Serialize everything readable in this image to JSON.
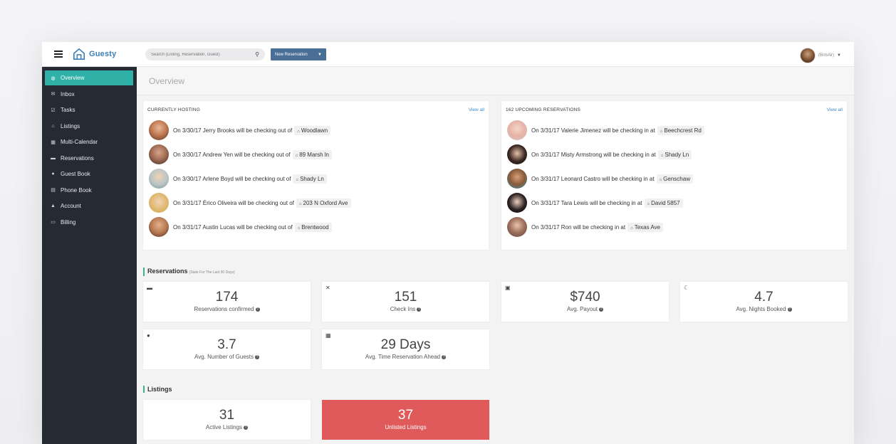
{
  "brand": {
    "name": "Guesty"
  },
  "search": {
    "placeholder": "Search (Listing, Reservation, Guest)"
  },
  "new_reservation": {
    "label": "New Reservation"
  },
  "user": {
    "name": "(BnbAir)"
  },
  "sidebar": {
    "items": [
      {
        "label": "Overview",
        "icon": "dashboard-icon",
        "glyph": "◍",
        "active": true
      },
      {
        "label": "Inbox",
        "icon": "envelope-icon",
        "glyph": "✉",
        "active": false
      },
      {
        "label": "Tasks",
        "icon": "checkbox-icon",
        "glyph": "☑",
        "active": false
      },
      {
        "label": "Listings",
        "icon": "home-icon",
        "glyph": "⌂",
        "active": false
      },
      {
        "label": "Multi-Calendar",
        "icon": "calendar-icon",
        "glyph": "▦",
        "active": false
      },
      {
        "label": "Reservations",
        "icon": "bed-icon",
        "glyph": "▬",
        "active": false
      },
      {
        "label": "Guest Book",
        "icon": "users-icon",
        "glyph": "●",
        "active": false
      },
      {
        "label": "Phone Book",
        "icon": "book-icon",
        "glyph": "▤",
        "active": false
      },
      {
        "label": "Account",
        "icon": "user-icon",
        "glyph": "▲",
        "active": false
      },
      {
        "label": "Billing",
        "icon": "credit-card-icon",
        "glyph": "▭",
        "active": false
      }
    ]
  },
  "page": {
    "title": "Overview"
  },
  "hosting": {
    "title": "CURRENTLY HOSTING",
    "view_all": "View all",
    "rows": [
      {
        "text": "On 3/30/17 Jerry Brooks will be checking out of",
        "location": "Woodlawn"
      },
      {
        "text": "On 3/30/17 Andrew Yen will be checking out of",
        "location": "89 Marsh ln"
      },
      {
        "text": "On 3/30/17 Arlene Boyd will be checking out of",
        "location": "Shady Ln"
      },
      {
        "text": "On 3/31/17 Érico Oliveira will be checking out of",
        "location": "203 N Oxford Ave"
      },
      {
        "text": "On 3/31/17 Austin Lucas will be checking out of",
        "location": "Brentwood"
      }
    ]
  },
  "upcoming": {
    "title": "162 UPCOMING RESERVATIONS",
    "view_all": "View all",
    "rows": [
      {
        "text": "On 3/31/17 Valerie Jimenez will be checking in at",
        "location": "Beechcrest Rd"
      },
      {
        "text": "On 3/31/17 Misty Armstrong will be checking in at",
        "location": "Shady Ln"
      },
      {
        "text": "On 3/31/17 Leonard Castro will be checking in at",
        "location": "Genschaw"
      },
      {
        "text": "On 3/31/17 Tara Lewis will be checking in at",
        "location": "David 5857"
      },
      {
        "text": "On 3/31/17 Ron will be checking in at",
        "location": "Texas Ave"
      }
    ]
  },
  "reservations_section": {
    "title": "Reservations",
    "subtitle": "(Stats For The Last 30 Days)"
  },
  "stats": [
    {
      "value": "174",
      "label": "Reservations confirmed",
      "icon": "bed-icon",
      "glyph": "▬"
    },
    {
      "value": "151",
      "label": "Check Ins",
      "icon": "key-icon",
      "glyph": "✕"
    },
    {
      "value": "$740",
      "label": "Avg. Payout",
      "icon": "money-icon",
      "glyph": "▣"
    },
    {
      "value": "4.7",
      "label": "Avg. Nights Booked",
      "icon": "moon-icon",
      "glyph": "☾"
    },
    {
      "value": "3.7",
      "label": "Avg. Number of Guests",
      "icon": "users-icon",
      "glyph": "●"
    },
    {
      "value": "29 Days",
      "label": "Avg. Time Reservation Ahead",
      "icon": "calendar-icon",
      "glyph": "▦"
    }
  ],
  "listings_section": {
    "title": "Listings"
  },
  "listings": [
    {
      "value": "31",
      "label": "Active Listings"
    },
    {
      "value": "37",
      "label": "Unlisted Listings"
    }
  ],
  "colors": {
    "accent": "#2fb1a7",
    "sidebar": "#252a33",
    "unlisted": "#e05a5c",
    "link": "#3b8bd0"
  }
}
